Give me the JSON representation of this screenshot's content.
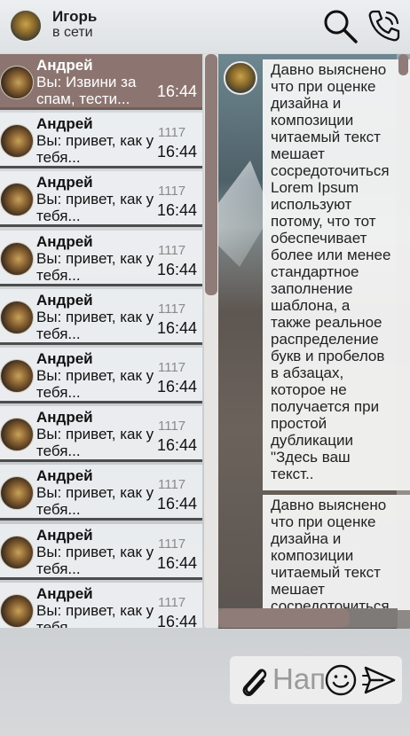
{
  "header": {
    "name": "Игорь",
    "status": "в сети",
    "icons": [
      "search-icon",
      "phone-icon"
    ]
  },
  "chats": [
    {
      "name": "Андрей",
      "preview": "Вы: Извини за спам, тести...",
      "count": "",
      "time": "16:44",
      "active": true
    },
    {
      "name": "Андрей",
      "preview": "Вы: привет, как у тебя...",
      "count": "1117",
      "time": "16:44",
      "active": false
    },
    {
      "name": "Андрей",
      "preview": "Вы: привет, как у тебя...",
      "count": "1117",
      "time": "16:44",
      "active": false
    },
    {
      "name": "Андрей",
      "preview": "Вы: привет, как у тебя...",
      "count": "1117",
      "time": "16:44",
      "active": false
    },
    {
      "name": "Андрей",
      "preview": "Вы: привет, как у тебя...",
      "count": "1117",
      "time": "16:44",
      "active": false
    },
    {
      "name": "Андрей",
      "preview": "Вы: привет, как у тебя...",
      "count": "1117",
      "time": "16:44",
      "active": false
    },
    {
      "name": "Андрей",
      "preview": "Вы: привет, как у тебя...",
      "count": "1117",
      "time": "16:44",
      "active": false
    },
    {
      "name": "Андрей",
      "preview": "Вы: привет, как у тебя...",
      "count": "1117",
      "time": "16:44",
      "active": false
    },
    {
      "name": "Андрей",
      "preview": "Вы: привет, как у тебя...",
      "count": "1117",
      "time": "16:44",
      "active": false
    },
    {
      "name": "Андрей",
      "preview": "Вы: привет, как у тебя...",
      "count": "1117",
      "time": "16:44",
      "active": false
    }
  ],
  "messages": [
    {
      "text": "Давно выяснено\nчто при оценке\nдизайна и\nкомпозиции\nчитаемый текст\nмешает\nсосредоточиться\nLorem Ipsum\nиспользуют\nпотому, что тот\nобеспечивает\nболее или менее\nстандартное\nзаполнение\nшаблона, а\nтакже реальное\nраспределение\nбукв и пробелов\nв абзацах,\nкоторое не\nполучается при\nпростой\nдубликации\n\"Здесь ваш\nтекст.."
    },
    {
      "text": "Давно выяснено\nчто при оценке\nдизайна и\nкомпозиции\nчитаемый текст\nмешает\nсосредоточиться"
    }
  ],
  "composer": {
    "placeholder": "Напишите сообщение...",
    "icons": [
      "paperclip-icon",
      "smile-icon",
      "send-icon"
    ]
  },
  "colors": {
    "accent": "#8c7570",
    "item_bg": "#eef0f2",
    "divider": "#4d4d4d"
  }
}
